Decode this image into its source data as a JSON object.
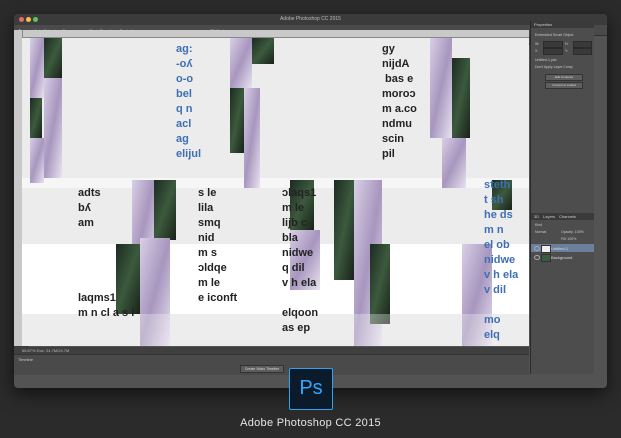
{
  "window": {
    "title": "Adobe Photoshop CC 2015"
  },
  "options_bar": {
    "auto_select": "Auto-Select:",
    "auto_select_value": "Group",
    "show_transform": "Show Transform Controls",
    "mode_3d": "3D Mode:"
  },
  "document_tab": {
    "label": "Untitled-1 @ 66.7% (RGB/8)"
  },
  "canvas_text": {
    "col1": "ag:\n-oʎ\no-o\nbel\nq n\nacl\nag\nelijul",
    "col2": "gy\nnijdA\n bas e\nmoroɔ\nm a.co\nndmu\nscin\npil",
    "col3": "adts\nbʎ\nam\n\n\n\n\nlaqms1\nm n cl a s i",
    "col4": "s le\nlila\nsmq\nnid\nm s\nɔldqe\nm le\ne iconft",
    "col5": "ɔlaqs1\nm le\nlijb c\nbla\nnidwe\nq dil\nv h ela\n\nelqoon\nas ep",
    "col6": "steth\nt sh\nhe ds\nm n\nel ob\nnidwe\nv h ela\nv dil\n\nmo\nelq"
  },
  "status_bar": {
    "text": "66.67%   Doc: 24.7M/24.7M"
  },
  "timeline": {
    "label": "Timeline",
    "button": "Create Video Timeline"
  },
  "properties": {
    "tab": "Properties",
    "title": "Embedded Smart Object",
    "w_label": "W:",
    "h_label": "H:",
    "x_label": "X:",
    "y_label": "Y:",
    "file_label": "Untitled-1.psb",
    "comps_label": "Don't Apply Layer Comp",
    "edit_button": "Edit Contents",
    "convert_button": "Convert to Linked"
  },
  "layers": {
    "tabs": [
      "3D",
      "Layers",
      "Channels"
    ],
    "kind": "Kind",
    "blend": "Normal",
    "opacity": "Opacity: 100%",
    "fill": "Fill: 100%",
    "items": [
      {
        "name": "Untitled-1"
      },
      {
        "name": "Background"
      }
    ]
  },
  "caption": "Adobe Photoshop CC 2015",
  "logo_text": "Ps"
}
